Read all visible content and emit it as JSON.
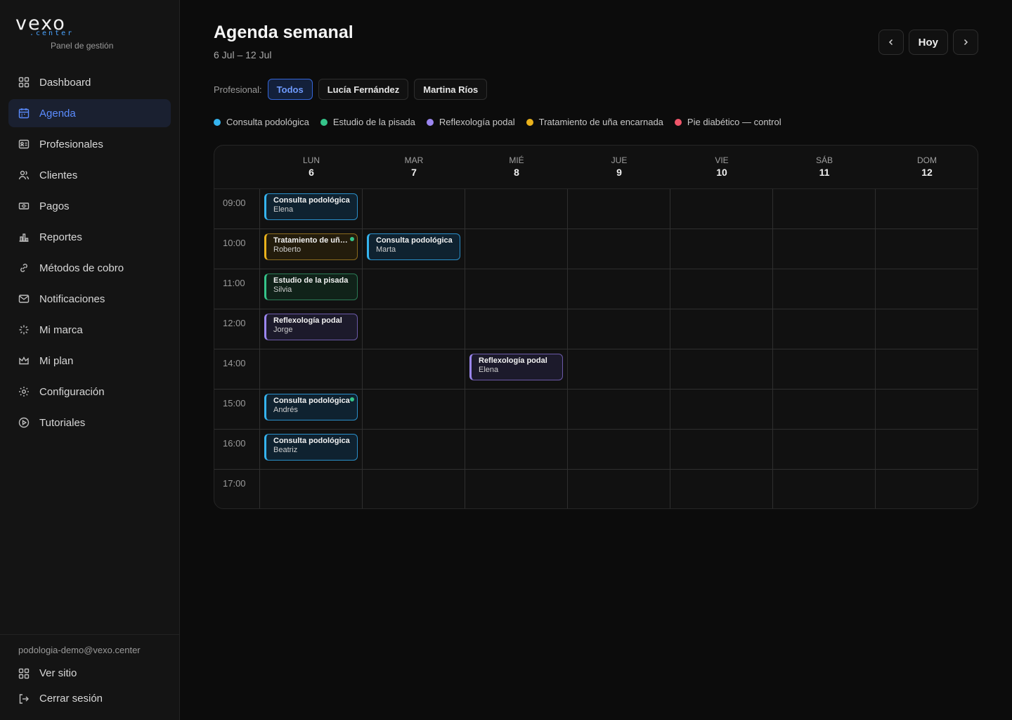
{
  "brand": {
    "logo": "vexo",
    "sub": ".center",
    "tagline": "Panel de gestión"
  },
  "sidebar": {
    "items": [
      {
        "label": "Dashboard",
        "icon": "grid-icon"
      },
      {
        "label": "Agenda",
        "icon": "calendar-icon",
        "active": true
      },
      {
        "label": "Profesionales",
        "icon": "id-card-icon"
      },
      {
        "label": "Clientes",
        "icon": "users-icon"
      },
      {
        "label": "Pagos",
        "icon": "banknote-icon"
      },
      {
        "label": "Reportes",
        "icon": "bar-chart-icon"
      },
      {
        "label": "Métodos de cobro",
        "icon": "link-icon"
      },
      {
        "label": "Notificaciones",
        "icon": "mail-icon"
      },
      {
        "label": "Mi marca",
        "icon": "sparkle-icon"
      },
      {
        "label": "Mi plan",
        "icon": "crown-icon"
      },
      {
        "label": "Configuración",
        "icon": "gear-icon"
      },
      {
        "label": "Tutoriales",
        "icon": "play-circle-icon"
      }
    ],
    "footer": {
      "email": "podologia-demo@vexo.center",
      "view_site": "Ver sitio",
      "logout": "Cerrar sesión"
    }
  },
  "header": {
    "title": "Agenda semanal",
    "range": "6 Jul – 12 Jul",
    "today_label": "Hoy"
  },
  "filter": {
    "label": "Profesional:",
    "options": [
      "Todos",
      "Lucía Fernández",
      "Martina Ríos"
    ],
    "selected": "Todos"
  },
  "legend": [
    {
      "label": "Consulta podológica",
      "color": "#35b4ef"
    },
    {
      "label": "Estudio de la pisada",
      "color": "#35c48a"
    },
    {
      "label": "Reflexología podal",
      "color": "#9b86f0"
    },
    {
      "label": "Tratamiento de uña encarnada",
      "color": "#eab21c"
    },
    {
      "label": "Pie diabético — control",
      "color": "#f0566a"
    }
  ],
  "calendar": {
    "days": [
      {
        "name": "LUN",
        "num": "6"
      },
      {
        "name": "MAR",
        "num": "7"
      },
      {
        "name": "MIÉ",
        "num": "8"
      },
      {
        "name": "JUE",
        "num": "9"
      },
      {
        "name": "VIE",
        "num": "10"
      },
      {
        "name": "SÁB",
        "num": "11"
      },
      {
        "name": "DOM",
        "num": "12"
      }
    ],
    "hours": [
      "09:00",
      "10:00",
      "11:00",
      "12:00",
      "14:00",
      "15:00",
      "16:00",
      "17:00"
    ],
    "appointments": [
      {
        "service": "Consulta podológica",
        "client": "Elena",
        "day": "LUN",
        "hour": "09:00",
        "color": "blue"
      },
      {
        "service": "Tratamiento de uña...",
        "client": "Roberto",
        "day": "LUN",
        "hour": "10:00",
        "color": "yellow",
        "confirmed": true
      },
      {
        "service": "Consulta podológica",
        "client": "Marta",
        "day": "MAR",
        "hour": "10:00",
        "color": "blue"
      },
      {
        "service": "Estudio de la pisada",
        "client": "Silvia",
        "day": "LUN",
        "hour": "11:00",
        "color": "green"
      },
      {
        "service": "Reflexología podal",
        "client": "Jorge",
        "day": "LUN",
        "hour": "12:00",
        "color": "purple"
      },
      {
        "service": "Reflexología podal",
        "client": "Elena",
        "day": "MIÉ",
        "hour": "14:00",
        "color": "purple"
      },
      {
        "service": "Consulta podológica",
        "client": "Andrés",
        "day": "LUN",
        "hour": "15:00",
        "color": "blue",
        "confirmed": true
      },
      {
        "service": "Consulta podológica",
        "client": "Beatriz",
        "day": "LUN",
        "hour": "16:00",
        "color": "blue"
      }
    ]
  }
}
